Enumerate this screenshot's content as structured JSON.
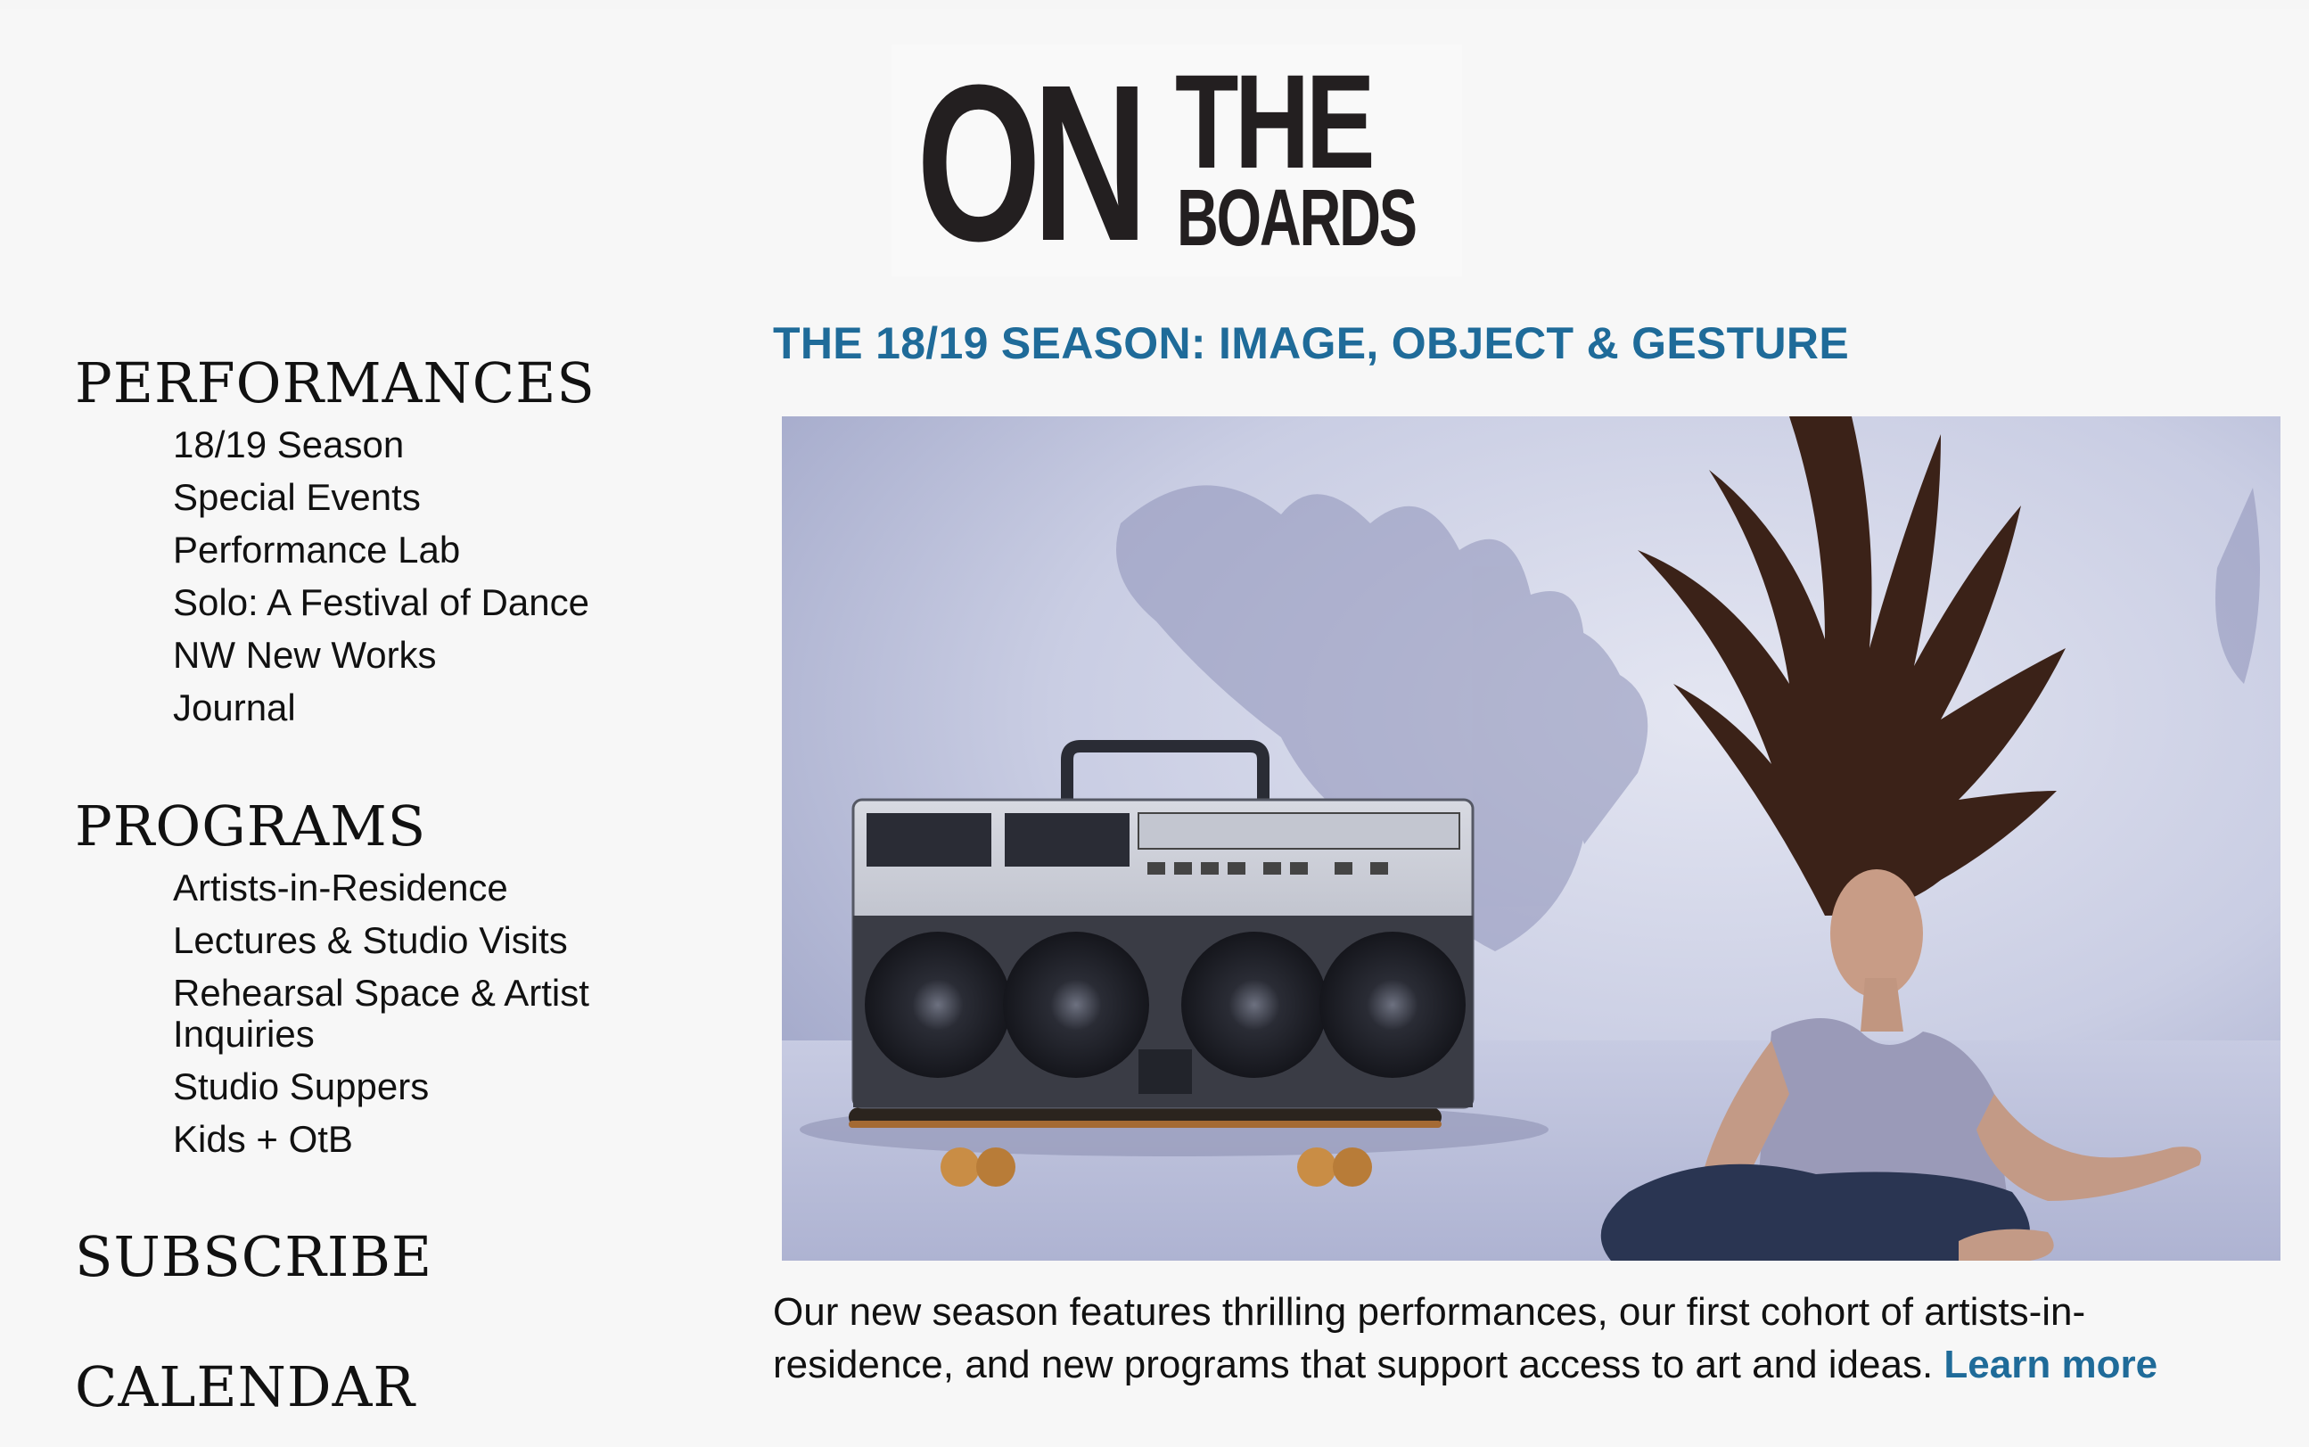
{
  "logo": {
    "word_on": "ON",
    "word_the": "THE",
    "word_boards": "BOARDS"
  },
  "sidebar": {
    "sections": [
      {
        "title": "PERFORMANCES",
        "items": [
          "18/19 Season",
          "Special Events",
          "Performance Lab",
          "Solo: A Festival of Dance",
          "NW New Works",
          "Journal"
        ]
      },
      {
        "title": "PROGRAMS",
        "items": [
          "Artists-in-Residence",
          "Lectures & Studio Visits",
          "Rehearsal Space & Artist Inquiries",
          "Studio Suppers",
          "Kids + OtB"
        ]
      },
      {
        "title": "SUBSCRIBE",
        "items": []
      },
      {
        "title": "CALENDAR",
        "items": []
      }
    ]
  },
  "main": {
    "headline": "THE 18/19 SEASON: IMAGE, OBJECT & GESTURE",
    "body": "Our new season features thrilling performances, our first cohort of artists-in-residence, and new programs that support access to art and ideas.",
    "link_label": "Learn more"
  },
  "colors": {
    "accent": "#1f6b99",
    "text": "#111111",
    "background": "#f7f7f7",
    "logo": "#231f20"
  },
  "hero_image": {
    "description_icon": "dancer-with-boombox-photo"
  }
}
